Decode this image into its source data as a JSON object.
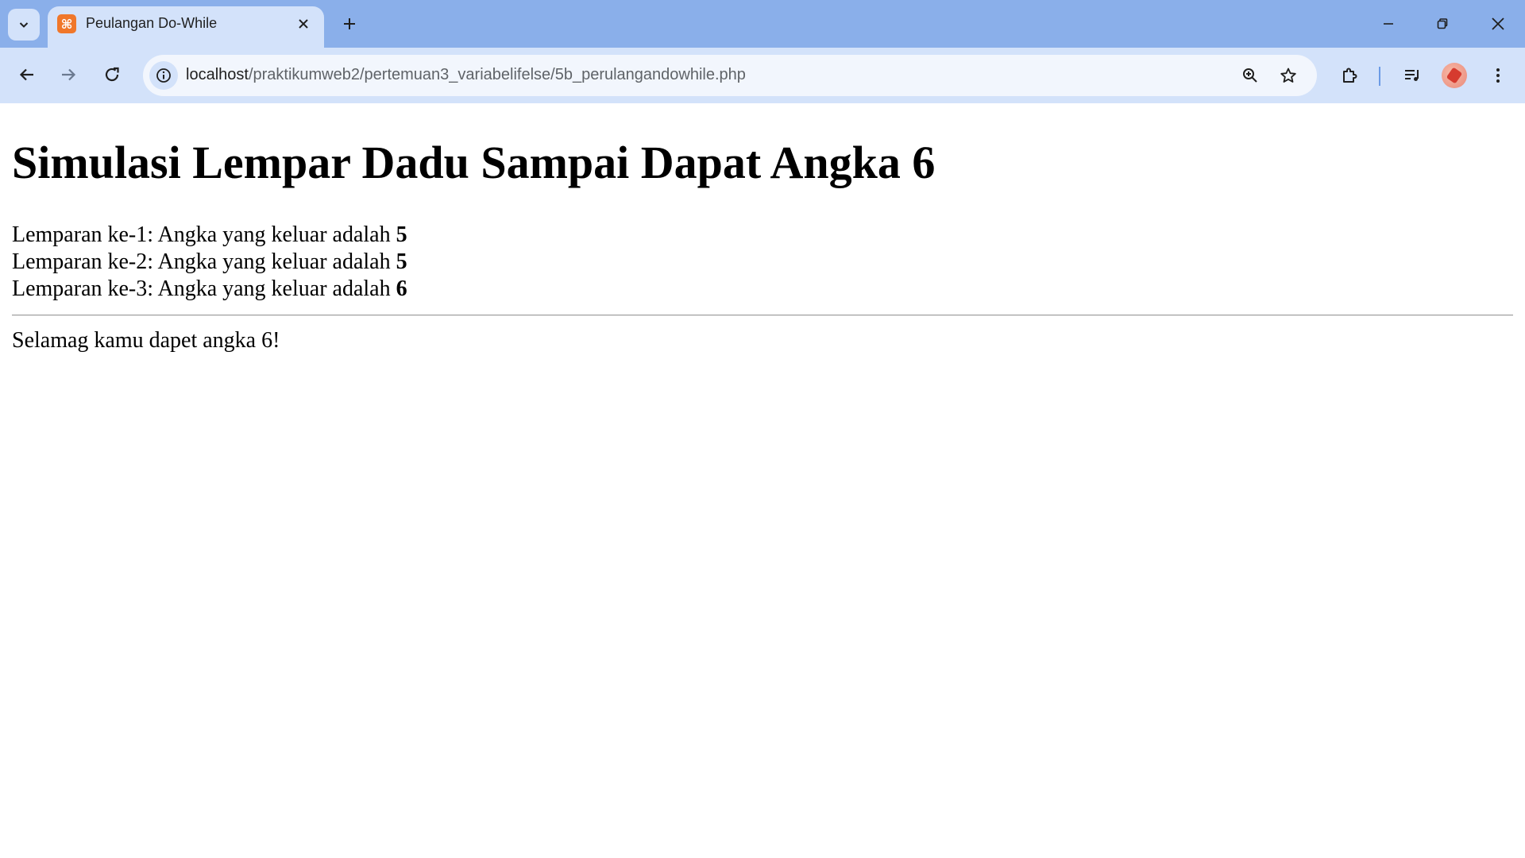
{
  "browser": {
    "tab": {
      "title": "Peulangan Do-While",
      "favicon_icon": "xampp-icon",
      "favicon_color": "#f0772a"
    },
    "address_bar": {
      "host": "localhost",
      "path": "/praktikumweb2/pertemuan3_variabelifelse/5b_perulangandowhile.php"
    },
    "colors": {
      "frame": "#8aafea",
      "toolbar": "#d3e2fa",
      "omnibox": "#f2f6fd"
    }
  },
  "page": {
    "heading": "Simulasi Lempar Dadu Sampai Dapat Angka 6",
    "rolls": [
      {
        "label": "Lemparan ke-1: Angka yang keluar adalah ",
        "value": "5"
      },
      {
        "label": "Lemparan ke-2: Angka yang keluar adalah ",
        "value": "5"
      },
      {
        "label": "Lemparan ke-3: Angka yang keluar adalah ",
        "value": "6"
      }
    ],
    "result": "Selamag kamu dapet angka 6!"
  }
}
